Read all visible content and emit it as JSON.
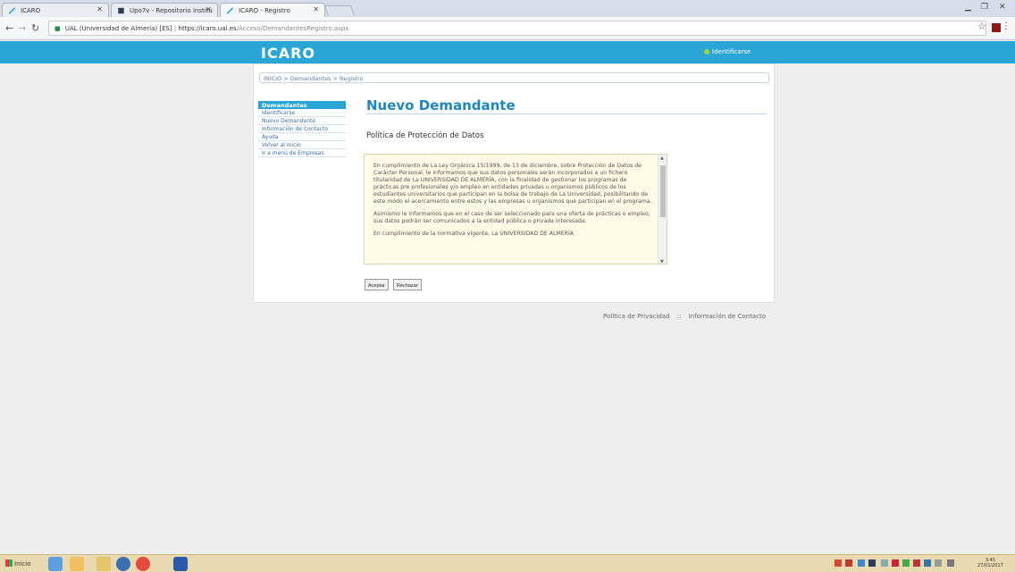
{
  "browser": {
    "tabs": [
      {
        "title": "ICARO",
        "active": false
      },
      {
        "title": "Upo7v - Repositorio institu",
        "active": false
      },
      {
        "title": "ICARO - Registro",
        "active": true
      }
    ],
    "url_security": "UAL (Universidad de Almería) [ES]",
    "url_host": "https://icaro.ual.es",
    "url_path": "/Acceso/DemandantesRegistro.aspx"
  },
  "site": {
    "logo": "ICARO",
    "login_link": "Identificarse",
    "breadcrumb": "INICIO > Demandantes > Registro"
  },
  "sidebar": {
    "header": "Demandantes",
    "items": [
      {
        "label": "Identificarse"
      },
      {
        "label": "Nuevo Demandante"
      },
      {
        "label": "Información de Contacto"
      },
      {
        "label": "Ayuda"
      },
      {
        "label": "Volver al Inicio"
      },
      {
        "label": "Ir a menú de Empresas"
      }
    ]
  },
  "main": {
    "title": "Nuevo Demandante",
    "section_title": "Política de Protección de Datos",
    "policy_paragraphs": [
      "En cumplimiento de La Ley Orgánica 15/1999, de 13 de diciembre, sobre Protección de Datos de Carácter Personal, le informamos que sus datos personales serán incorporados a un fichero titularidad de La UNIVERSIDAD DE ALMERÍA, con la finalidad de gestionar los programas de prácticas pre profesionales y/o empleo en entidades privadas u organismos públicos de los estudiantes universitarios que participan en la bolsa de trabajo de La Universidad, posibilitando de este modo el acercamiento entre estos y las empresas u organismos que participan en el programa.",
      "Asimismo le informamos que en el caso de ser seleccionado para una oferta de prácticas o empleo, sus datos podrán ser comunicados a la entidad pública o privada interesada.",
      "En cumplimiento de la normativa vigente, La UNIVERSIDAD DE ALMERÍA"
    ],
    "accept_button": "Aceptar",
    "reject_button": "Rechazar"
  },
  "footer": {
    "privacy": "Política de Privacidad",
    "separator": "::",
    "contact": "Información de Contacto"
  },
  "taskbar": {
    "start_label": "Inicio",
    "clock_time": "3:45",
    "clock_date": "27/01/2017"
  },
  "colors": {
    "brand": "#2aa6d6",
    "title": "#1f86c0",
    "link": "#3a6ea5",
    "policy_bg": "#fffbe6"
  }
}
